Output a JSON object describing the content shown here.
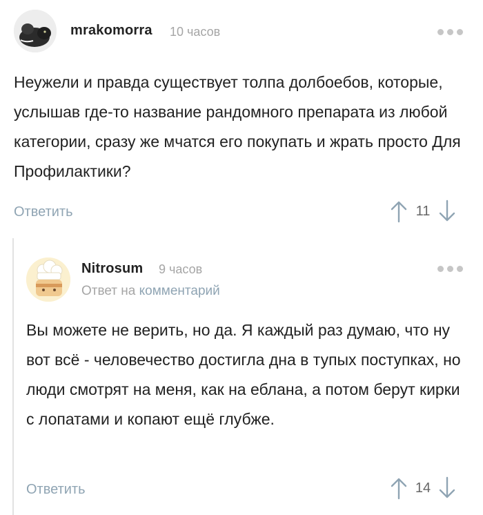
{
  "comments": [
    {
      "author": "mrakomorra",
      "time": "10 часов",
      "text": "Неужели и правда существует толпа долбоебов, которые, услышав где-то название рандомного препарата из любой категории, сразу же мчатся его покупать и жрать просто Для Профилактики?",
      "reply_label": "Ответить",
      "score": "11"
    },
    {
      "author": "Nitrosum",
      "time": "9 часов",
      "reply_to_prefix": "Ответ на",
      "reply_to_link": "комментарий",
      "text": "Вы можете не верить, но да. Я каждый раз думаю, что ну вот всё - человечество достигла дна в тупых поступках, но люди смотрят на меня, как на еблана, а потом берут кирки с лопатами и копают ещё глубже.",
      "reply_label": "Ответить",
      "score": "14"
    }
  ],
  "icons": {
    "upvote": "arrow-up-icon",
    "downvote": "arrow-down-icon",
    "more": "more-dots-icon"
  },
  "colors": {
    "link": "#8fa4b3",
    "muted": "#a5a5a5",
    "text": "#222222"
  }
}
